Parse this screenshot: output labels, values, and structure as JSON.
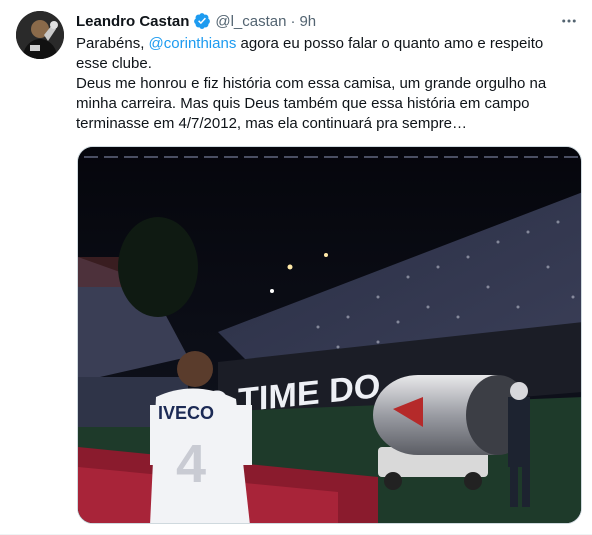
{
  "tweet": {
    "author_name": "Leandro Castan",
    "handle": "@l_castan",
    "separator": "·",
    "time": "9h",
    "text": {
      "line1_before": "Parabéns, ",
      "mention": "@corinthians",
      "line1_after": " agora eu posso falar o quanto amo e respeito esse clube.",
      "paragraph2": "Deus me honrou e fiz história com essa camisa, um grande orgulho na minha carreira. Mas quis Deus também que essa história em campo terminasse em 4/7/2012, mas ela continuará pra sempre…"
    },
    "media": {
      "banner_text": "O TIME DO",
      "jersey_sponsor": "IVECO",
      "jersey_number": "4"
    }
  },
  "colors": {
    "link": "#1d9bf0",
    "verified": "#1d9bf0",
    "secondary_text": "#536471",
    "primary_text": "#0f1419"
  },
  "icons": {
    "verified": "verified-badge-icon",
    "more": "more-options-icon"
  }
}
